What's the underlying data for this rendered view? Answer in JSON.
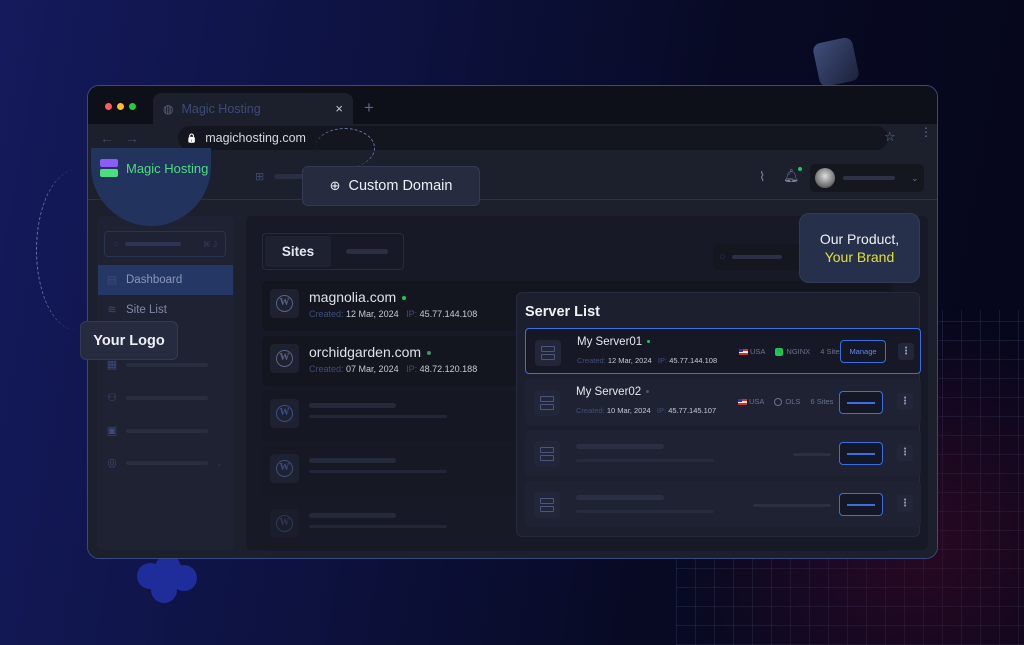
{
  "browser": {
    "tab_title": "Magic Hosting",
    "tab_close": "×",
    "new_tab": "+",
    "back": "←",
    "forward": "→",
    "url": "magichosting.com",
    "lock_icon": "🔒",
    "bookmark_icon": "☆",
    "menu_icon": "⋮",
    "traffic_lights": [
      "#ff5f57",
      "#febc2e",
      "#28c840"
    ]
  },
  "brand": {
    "name": "Magic Hosting",
    "color": "#4ade80"
  },
  "callouts": {
    "custom_domain": "Custom Domain",
    "your_logo": "Your Logo",
    "brand_line1": "Our Product,",
    "brand_line2": "Your Brand",
    "brand_accent": "#e0e03a"
  },
  "sidebar": {
    "search_shortcut": "⌘ J",
    "items": [
      {
        "label": "Dashboard",
        "icon": "dashboard-icon",
        "active": true
      },
      {
        "label": "Site List",
        "icon": "layers-icon",
        "active": false
      }
    ]
  },
  "main": {
    "tabs": [
      {
        "label": "Sites"
      }
    ],
    "sites": [
      {
        "name": "magnolia.com",
        "status": "online",
        "created_label": "Created:",
        "created": "12 Mar, 2024",
        "ip_label": "IP:",
        "ip": "45.77.144.108"
      },
      {
        "name": "orchidgarden.com",
        "status": "online",
        "created_label": "Created:",
        "created": "07 Mar, 2024",
        "ip_label": "IP:",
        "ip": "48.72.120.188"
      }
    ]
  },
  "server_list": {
    "title": "Server List",
    "servers": [
      {
        "name": "My Server01",
        "created_label": "Created:",
        "created": "12 Mar, 2024",
        "ip_label": "IP:",
        "ip": "45.77.144.108",
        "country": "USA",
        "stack": "NGINX",
        "sites": "4 Sites",
        "action": "Manage",
        "selected": true
      },
      {
        "name": "My Server02",
        "created_label": "Created:",
        "created": "10 Mar, 2024",
        "ip_label": "IP:",
        "ip": "45.77.145.107",
        "country": "USA",
        "stack": "OLS",
        "sites": "6 Sites",
        "selected": false
      }
    ]
  },
  "accent_color": "#3b6ee0"
}
